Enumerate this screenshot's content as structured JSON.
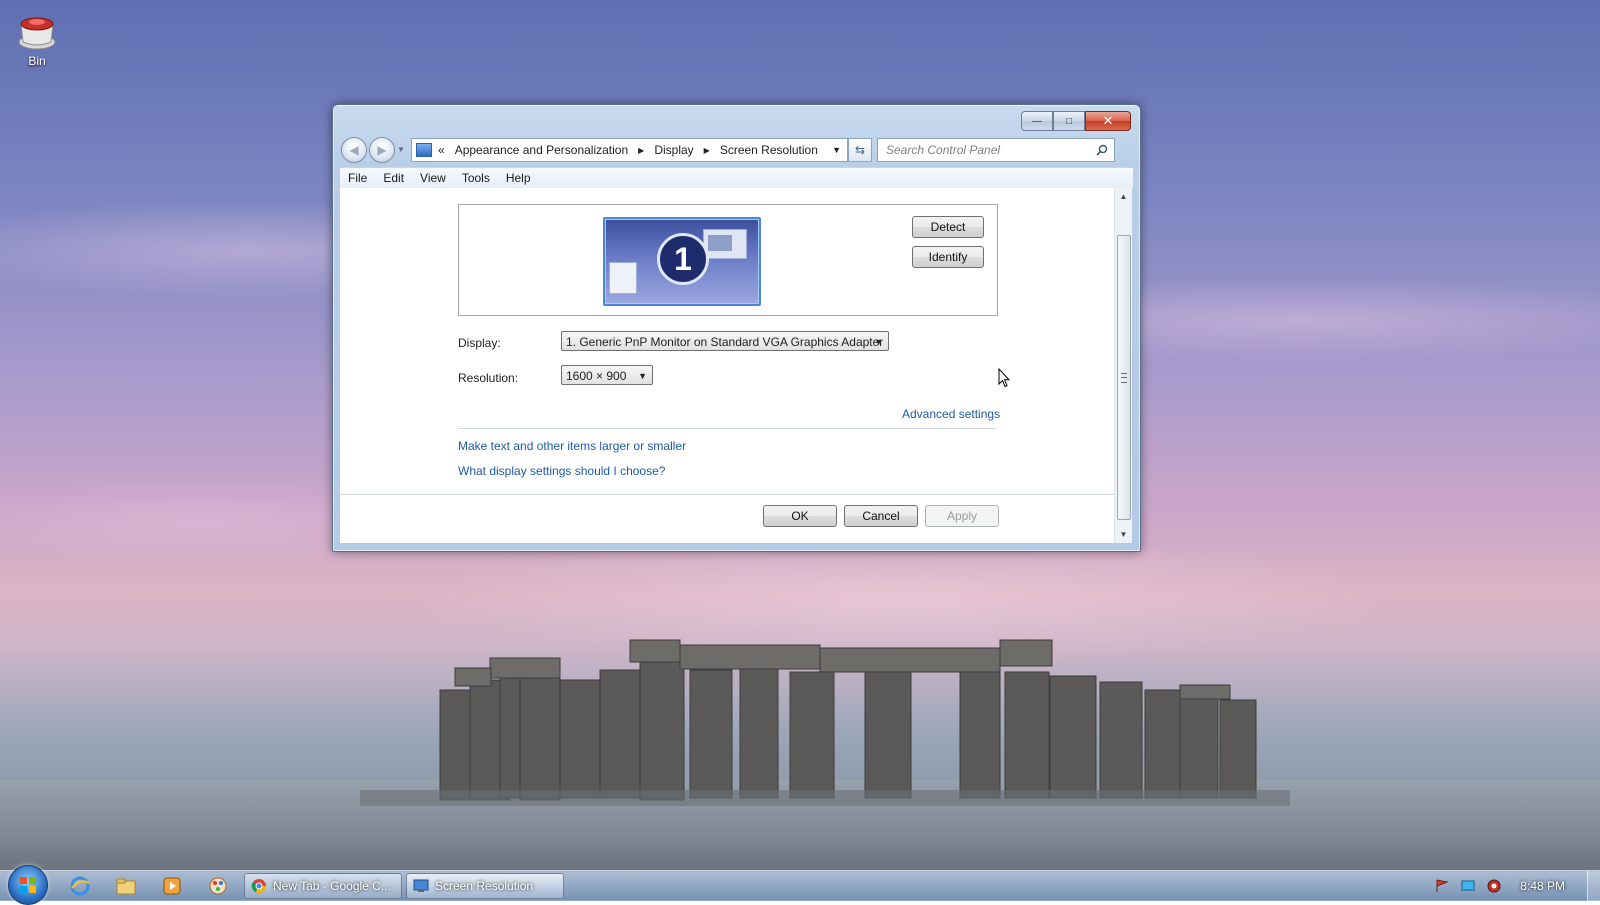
{
  "desktop": {
    "icons": [
      {
        "label": "Bin",
        "icon": "recycle-bin-icon"
      }
    ]
  },
  "window": {
    "caption": {
      "minimize": "—",
      "maximize": "□",
      "close": "✕"
    },
    "address": {
      "prefix": "«",
      "crumbs": [
        "Appearance and Personalization",
        "Display",
        "Screen Resolution"
      ]
    },
    "search_placeholder": "Search Control Panel",
    "menu": [
      "File",
      "Edit",
      "View",
      "Tools",
      "Help"
    ],
    "preview": {
      "monitor_number": "1"
    },
    "buttons": {
      "detect": "Detect",
      "identify": "Identify",
      "ok": "OK",
      "cancel": "Cancel",
      "apply": "Apply"
    },
    "display": {
      "label": "Display:",
      "value": "1. Generic PnP Monitor on Standard VGA Graphics Adapter"
    },
    "resolution": {
      "label": "Resolution:",
      "value": "1600 × 900"
    },
    "links": {
      "advanced": "Advanced settings",
      "text_size": "Make text and other items larger or smaller",
      "which_settings": "What display settings should I choose?"
    }
  },
  "taskbar": {
    "tasks": [
      {
        "label": "New Tab - Google C...",
        "icon": "chrome-icon"
      },
      {
        "label": "Screen Resolution",
        "icon": "control-panel-icon"
      }
    ],
    "pinned": [
      "internet-explorer-icon",
      "folder-icon",
      "media-player-icon",
      "paint-icon"
    ],
    "clock": "8:48 PM"
  },
  "colors": {
    "link": "#1e5aa8",
    "close_button": "#c23e23",
    "monitor": "#3b4f9e"
  }
}
